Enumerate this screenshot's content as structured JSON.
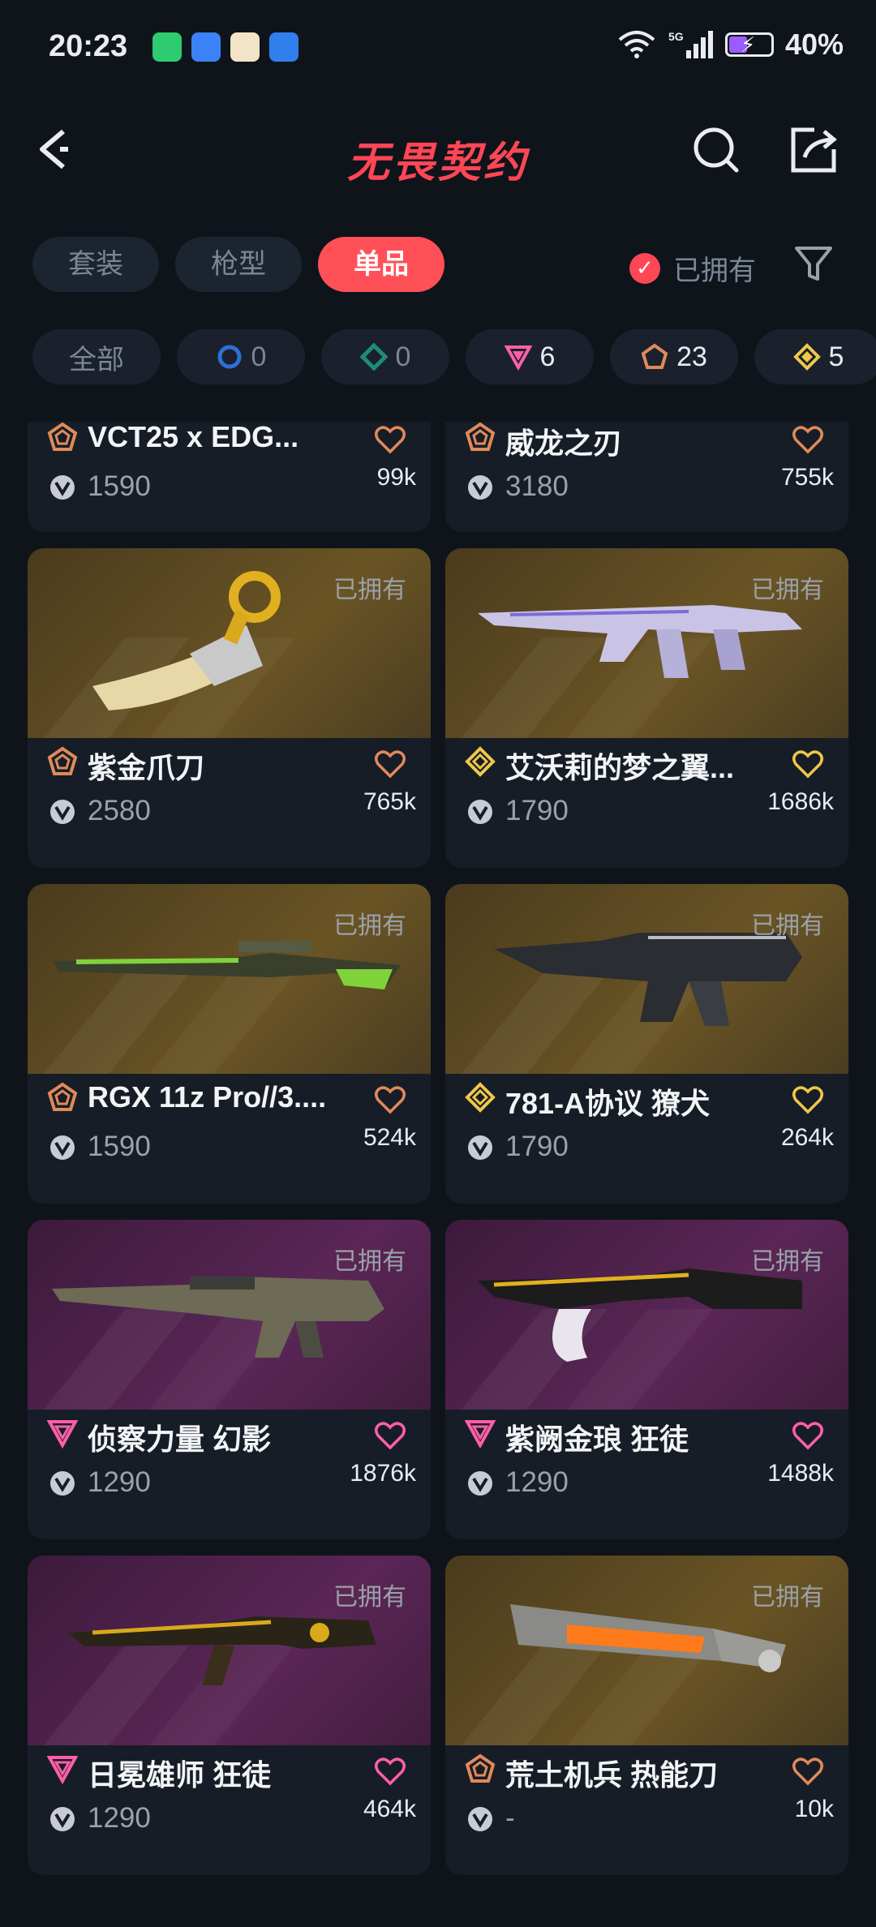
{
  "status": {
    "time": "20:23",
    "network": "5G",
    "battery": "40%"
  },
  "header": {
    "title": "无畏契约"
  },
  "tabs": [
    {
      "label": "套装"
    },
    {
      "label": "枪型"
    },
    {
      "label": "单品"
    }
  ],
  "owned_filter_label": "已拥有",
  "tiers": [
    {
      "count": "全部"
    },
    {
      "count": "0"
    },
    {
      "count": "0"
    },
    {
      "count": "6"
    },
    {
      "count": "23"
    },
    {
      "count": "5"
    }
  ],
  "colors": {
    "accent": "#ff4655",
    "deluxe": "#e08a5a",
    "exclusive": "#f0c74a",
    "premium": "#ff5fa8"
  },
  "items": [
    {
      "name": "VCT25 x EDG...",
      "price": "1590",
      "likes": "99k",
      "tier": "deluxe",
      "owned": ""
    },
    {
      "name": "威龙之刃",
      "price": "3180",
      "likes": "755k",
      "tier": "deluxe",
      "owned": ""
    },
    {
      "name": "紫金爪刀",
      "price": "2580",
      "likes": "765k",
      "tier": "deluxe",
      "owned": "已拥有",
      "art": "gold"
    },
    {
      "name": "艾沃莉的梦之翼...",
      "price": "1790",
      "likes": "1686k",
      "tier": "exclusive",
      "owned": "已拥有",
      "art": "gold"
    },
    {
      "name": "RGX 11z Pro//3....",
      "price": "1590",
      "likes": "524k",
      "tier": "deluxe",
      "owned": "已拥有",
      "art": "gold"
    },
    {
      "name": "781-A协议 獠犬",
      "price": "1790",
      "likes": "264k",
      "tier": "exclusive",
      "owned": "已拥有",
      "art": "gold"
    },
    {
      "name": "侦察力量 幻影",
      "price": "1290",
      "likes": "1876k",
      "tier": "premium",
      "owned": "已拥有",
      "art": "pink"
    },
    {
      "name": "紫阙金琅 狂徒",
      "price": "1290",
      "likes": "1488k",
      "tier": "premium",
      "owned": "已拥有",
      "art": "pink"
    },
    {
      "name": "日冕雄师 狂徒",
      "price": "1290",
      "likes": "464k",
      "tier": "premium",
      "owned": "已拥有",
      "art": "pink"
    },
    {
      "name": "荒土机兵 热能刀",
      "price": "-",
      "likes": "10k",
      "tier": "deluxe",
      "owned": "已拥有",
      "art": "gold"
    }
  ]
}
